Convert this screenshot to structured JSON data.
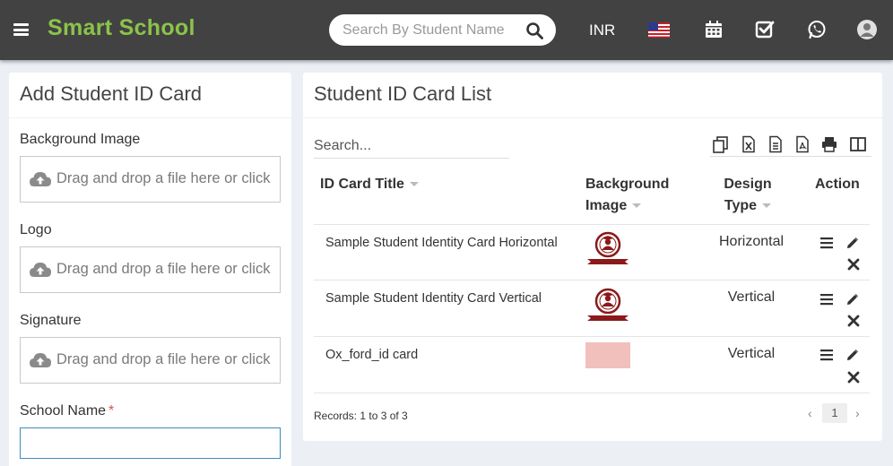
{
  "header": {
    "brand": "Smart School",
    "search_placeholder": "Search By Student Name",
    "currency": "INR",
    "icons": [
      "menu-icon",
      "search-icon",
      "us-flag-icon",
      "calendar-icon",
      "checkbox-icon",
      "whatsapp-icon",
      "user-avatar-icon"
    ]
  },
  "left_panel": {
    "title": "Add Student ID Card",
    "fields": [
      {
        "label": "Background Image",
        "dropzone_text": "Drag and drop a file here or click"
      },
      {
        "label": "Logo",
        "dropzone_text": "Drag and drop a file here or click"
      },
      {
        "label": "Signature",
        "dropzone_text": "Drag and drop a file here or click"
      }
    ],
    "school_name_label": "School Name",
    "required_mark": "*",
    "school_name_value": ""
  },
  "right_panel": {
    "title": "Student ID Card List",
    "search_placeholder": "Search...",
    "toolbar_icons": [
      "copy-icon",
      "excel-icon",
      "csv-icon",
      "pdf-icon",
      "print-icon",
      "columns-icon"
    ],
    "columns": {
      "title": "ID Card Title",
      "bg_line1": "Background",
      "bg_line2": "Image",
      "design_line1": "Design",
      "design_line2": "Type",
      "action": "Action"
    },
    "rows": [
      {
        "title": "Sample Student Identity Card Horizontal",
        "design_type": "Horizontal",
        "image": "school-logo"
      },
      {
        "title": "Sample Student Identity Card Vertical",
        "design_type": "Vertical",
        "image": "school-logo"
      },
      {
        "title": "Ox_ford_id card",
        "design_type": "Vertical",
        "image": "pink-swatch"
      }
    ],
    "records_text": "Records: 1 to 3 of 3",
    "pagination": {
      "prev": "‹",
      "current": "1",
      "next": "›"
    }
  },
  "colors": {
    "header_bg": "#424242",
    "brand_green": "#8bc34a",
    "page_bg": "#ecf0f5",
    "input_focus": "#3c8dbc",
    "required_red": "#d9534f",
    "swatch_pink": "#f2c0bc"
  }
}
